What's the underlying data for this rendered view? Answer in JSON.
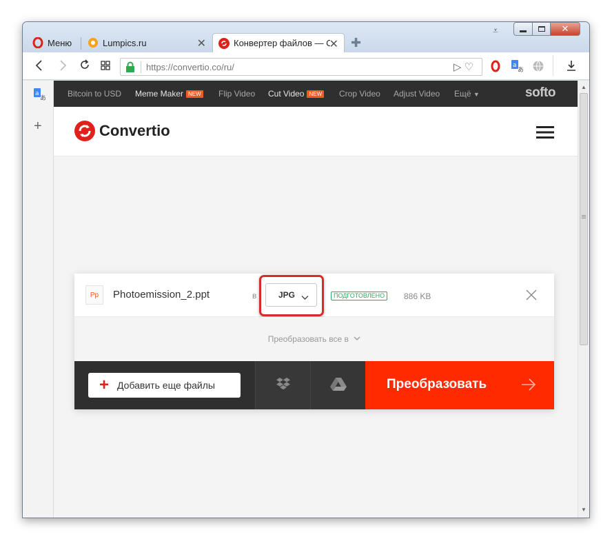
{
  "browser": {
    "menu_label": "Меню",
    "tabs": [
      {
        "title": "Lumpics.ru"
      },
      {
        "title": "Конвертер файлов — Co"
      }
    ],
    "address": "https://convertio.co/ru/"
  },
  "site_nav": {
    "items": [
      "Bitcoin to USD",
      "Meme Maker",
      "Flip Video",
      "Cut Video",
      "Crop Video",
      "Adjust Video",
      "Ещё"
    ],
    "new_badge": "NEW",
    "brand": "softo"
  },
  "header": {
    "logo": "Convertio"
  },
  "file": {
    "icon_text": "Pp",
    "name": "Photoemission_2.ppt",
    "to_label": "в",
    "format": "JPG",
    "status": "ПОДГОТОВЛЕНО",
    "size": "886 KB"
  },
  "convert_all": {
    "label": "Преобразовать все в"
  },
  "actions": {
    "add_files": "Добавить еще файлы",
    "convert": "Преобразовать"
  },
  "colors": {
    "accent": "#ff2a00",
    "status_green": "#27ae60",
    "dark_bar": "#2f2f2f",
    "highlight": "#d62b2b"
  }
}
